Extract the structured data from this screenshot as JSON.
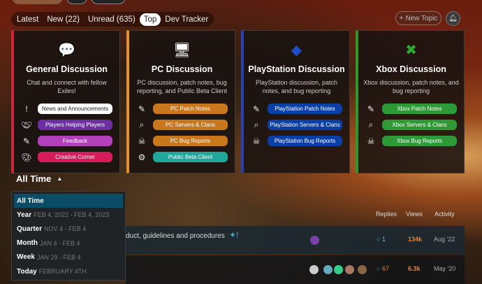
{
  "tabs": [
    {
      "label": "Latest"
    },
    {
      "label": "New (22)"
    },
    {
      "label": "Unread (635)"
    },
    {
      "label": "Top"
    },
    {
      "label": "Dev Tracker"
    }
  ],
  "new_topic": "New Topic",
  "categories": [
    {
      "title": "General Discussion",
      "desc": "Chat and connect with fellow Exiles!",
      "color": "#c8273c",
      "links": [
        {
          "label": "News and Announcements",
          "color": "#ffffff",
          "text": "#222"
        },
        {
          "label": "Players Helping Players",
          "color": "#6b2fa3",
          "text": "#fff"
        },
        {
          "label": "Feedback",
          "color": "#b240b8",
          "text": "#fff"
        },
        {
          "label": "Creative Corner",
          "color": "#d81b5a",
          "text": "#fff"
        }
      ]
    },
    {
      "title": "PC Discussion",
      "desc": "PC discussion, patch notes, bug reporting, and Public Beta Client",
      "color": "#e8911e",
      "links": [
        {
          "label": "PC Patch Notes",
          "color": "#c9771c",
          "text": "#fff"
        },
        {
          "label": "PC Servers & Clans",
          "color": "#c9771c",
          "text": "#fff"
        },
        {
          "label": "PC Bug Reports",
          "color": "#c9771c",
          "text": "#fff"
        },
        {
          "label": "Public Beta Client",
          "color": "#1fa89a",
          "text": "#fff"
        }
      ]
    },
    {
      "title": "PlayStation Discussion",
      "desc": "PlayStation discussion, patch notes, and bug reporting",
      "color": "#2a3fb0",
      "links": [
        {
          "label": "PlayStation Patch Notes",
          "color": "#0b3fa8",
          "text": "#fff"
        },
        {
          "label": "PlayStation Servers & Clans",
          "color": "#0b3fa8",
          "text": "#fff"
        },
        {
          "label": "PlayStation Bug Reports",
          "color": "#0b3fa8",
          "text": "#fff"
        }
      ]
    },
    {
      "title": "Xbox Discussion",
      "desc": "Xbox discussion, patch notes, and bug reporting",
      "color": "#2a9a2a",
      "links": [
        {
          "label": "Xbox Patch Notes",
          "color": "#2e9a36",
          "text": "#fff"
        },
        {
          "label": "Xbox Servers & Clans",
          "color": "#2e9a36",
          "text": "#fff"
        },
        {
          "label": "Xbox Bug Reports",
          "color": "#2e9a36",
          "text": "#fff"
        }
      ]
    }
  ],
  "period": {
    "current": "All Time",
    "options": [
      {
        "label": "All Time",
        "range": ""
      },
      {
        "label": "Year",
        "range": "FEB 4, 2022 - FEB 4, 2023"
      },
      {
        "label": "Quarter",
        "range": "NOV 4 - FEB 4"
      },
      {
        "label": "Month",
        "range": "JAN 4 - FEB 4"
      },
      {
        "label": "Week",
        "range": "JAN 29 - FEB 4"
      },
      {
        "label": "Today",
        "range": "FEBRUARY 4TH"
      }
    ]
  },
  "columns": {
    "replies": "Replies",
    "views": "Views",
    "activity": "Activity"
  },
  "topics": [
    {
      "title": "duct, guidelines and procedures",
      "replies": "1",
      "views": "134k",
      "activity": "Aug '22"
    },
    {
      "title": "",
      "replies": "67",
      "views": "6.3k",
      "activity": "May '20"
    }
  ]
}
